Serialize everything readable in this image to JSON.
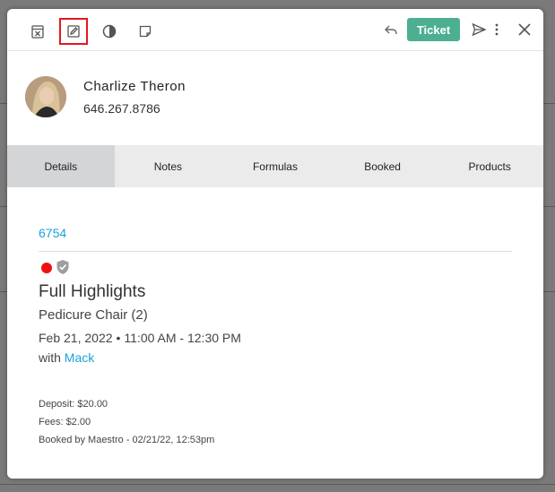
{
  "toolbar": {
    "icons": [
      "calendar-x-icon",
      "edit-icon",
      "contrast-icon",
      "note-icon"
    ],
    "ticket_label": "Ticket",
    "right_icons": [
      "reply-icon",
      "send-icon",
      "more-vertical-icon",
      "close-icon"
    ]
  },
  "client": {
    "name": "Charlize Theron",
    "phone": "646.267.8786"
  },
  "tabs": [
    {
      "label": "Details",
      "active": true
    },
    {
      "label": "Notes",
      "active": false
    },
    {
      "label": "Formulas",
      "active": false
    },
    {
      "label": "Booked",
      "active": false
    },
    {
      "label": "Products",
      "active": false
    }
  ],
  "appointment": {
    "id": "6754",
    "status_color": "#f01010",
    "service": "Full Highlights",
    "resource": "Pedicure Chair (2)",
    "date": "Feb 21, 2022",
    "time": "11:00 AM - 12:30 PM",
    "with_label": "with",
    "staff": "Mack",
    "deposit": "Deposit: $20.00",
    "fees": "Fees: $2.00",
    "booked_by": "Booked by Maestro - 02/21/22, 12:53pm"
  },
  "colors": {
    "accent": "#4caf91",
    "link": "#1aa3d9",
    "selected_outline": "#e0191f"
  }
}
